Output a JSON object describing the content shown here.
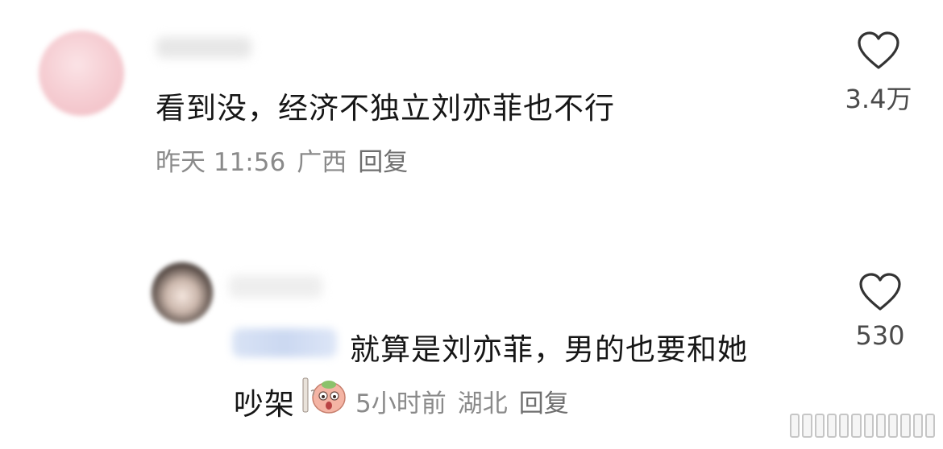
{
  "comments": [
    {
      "text": "看到没，经济不独立刘亦菲也不行",
      "meta": {
        "time": "昨天 11:56",
        "location": "广西",
        "reply": "回复"
      },
      "likes": "3.4万"
    },
    {
      "text_line1": "就算是刘亦菲，男的也要和她",
      "text_line2": "吵架",
      "meta": {
        "time": "5小时前",
        "location": "湖北",
        "reply": "回复"
      },
      "likes": "530"
    }
  ],
  "icons": {
    "like": "heart-outline-icon",
    "sticker": "peach-character-sticker"
  },
  "colors": {
    "text": "#161616",
    "meta": "#8a8a8a",
    "icon": "#333333"
  }
}
